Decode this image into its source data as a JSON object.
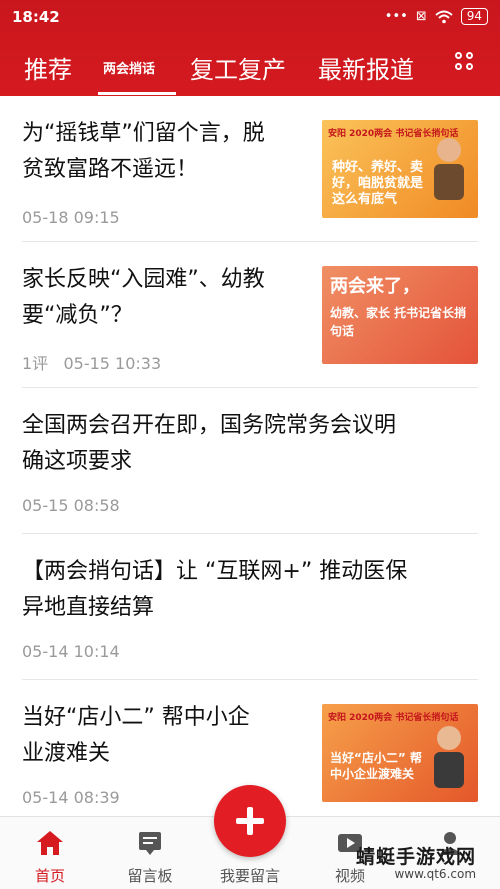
{
  "status_bar": {
    "time": "18:42",
    "battery": "94",
    "signal_text": "..."
  },
  "tabs": [
    {
      "label": "推荐"
    },
    {
      "label": "两会捎话"
    },
    {
      "label": "复工复产"
    },
    {
      "label": "最新报道"
    }
  ],
  "feed": [
    {
      "title_line1": "为“摇钱草”们留个言，脱",
      "title_line2": "贫致富路不遥远！",
      "meta": "05-18 09:15",
      "thumb": {
        "top_text": "安阳 2020两会 书记省长捎句话",
        "main_text": "种好、养好、卖好，咱脱贫就是这么有底气",
        "colors": {
          "bg": "#f5a623",
          "text": "#ffffff"
        }
      }
    },
    {
      "title_line1": "家长反映“入园难”、幼教",
      "title_line2": "要“减负”？",
      "comments": "1评",
      "meta": "05-15 10:33",
      "thumb": {
        "top_text": "两会来了，",
        "main_text": "幼教、家长 托书记省长捎句话",
        "colors": {
          "bg": "#e8744f",
          "text": "#ffffff"
        }
      }
    },
    {
      "title_line1": "全国两会召开在即，国务院常务会议明",
      "title_line2": "确这项要求",
      "meta": "05-15 08:58"
    },
    {
      "title_line1": "【两会捎句话】让 “互联网+” 推动医保",
      "title_line2": "异地直接结算",
      "meta": "05-14 10:14"
    },
    {
      "title_line1": "当好“店小二” 帮中小企",
      "title_line2": "业渡难关",
      "meta": "05-14 08:39",
      "thumb": {
        "top_text": "安阳 2020两会 书记省长捎句话",
        "main_text": "当好“店小二” 帮中小企业渡难关",
        "colors": {
          "bg": "#f07b2a",
          "text": "#ffffff"
        }
      }
    }
  ],
  "bottom_nav": [
    {
      "label": "首页",
      "icon": "home-icon",
      "active": true
    },
    {
      "label": "留言板",
      "icon": "message-board-icon"
    },
    {
      "label": "我要留言",
      "icon": "plus-icon"
    },
    {
      "label": "视频",
      "icon": "video-icon"
    },
    {
      "label": "",
      "icon": "user-icon"
    }
  ],
  "watermark": {
    "line1": "蜻蜓手游戏网",
    "line2": "www.qt6.com"
  },
  "colors": {
    "brand": "#d51a20",
    "meta": "#9a9a9a"
  }
}
